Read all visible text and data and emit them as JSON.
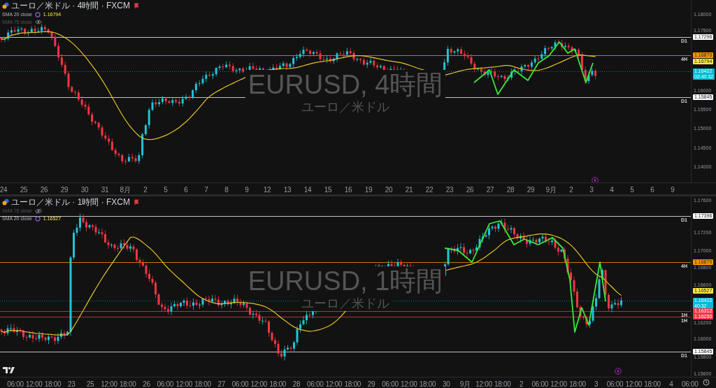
{
  "panes": [
    {
      "header": {
        "title": "ユーロ／米ドル · 4時間 · FXCM"
      },
      "indicators": [
        {
          "name": "SMA 20 close",
          "visible": true,
          "value": "1.16794"
        },
        {
          "name": "SMA 75 close",
          "visible": false
        }
      ],
      "watermark": {
        "symbol": "EURUSD, 4時間",
        "description": "ユーロ／米ドル"
      },
      "price_axis": [
        "1.18000",
        "1.17500",
        "1.16000",
        "1.15500",
        "1.15000",
        "1.14500",
        "1.14000"
      ],
      "price_tags": [
        {
          "kind": "level",
          "label": "D1",
          "price": "1.17296",
          "color": "#ffffff"
        },
        {
          "kind": "level",
          "label": "4H",
          "price": "1.16870",
          "color": "#ff9800"
        },
        {
          "kind": "indicator",
          "price": "1.16794",
          "color": "#ffeb3b"
        },
        {
          "kind": "last",
          "price": "1.16422",
          "countdown": "02:40:32",
          "color": "#00bcd4"
        },
        {
          "kind": "level",
          "label": "D1",
          "price": "1.15845",
          "color": "#ffffff"
        }
      ],
      "time_axis": [
        "24",
        "25",
        "26",
        "29",
        "30",
        "31",
        "8月",
        "2",
        "5",
        "6",
        "7",
        "8",
        "9",
        "12",
        "13",
        "14",
        "15",
        "16",
        "19",
        "20",
        "21",
        "22",
        "23",
        "26",
        "27",
        "28",
        "29",
        "9月",
        "2",
        "3",
        "4",
        "5",
        "6",
        "9"
      ]
    },
    {
      "header": {
        "title": "ユーロ／米ドル · 1時間 · FXCM"
      },
      "indicators": [
        {
          "name": "SMA 75 close",
          "visible": false
        },
        {
          "name": "SMA 20 close",
          "visible": true,
          "value": "1.16527"
        }
      ],
      "watermark": {
        "symbol": "EURUSD, 1時間",
        "description": "ユーロ／米ドル"
      },
      "price_axis": [
        "1.17600",
        "1.17200",
        "1.17000",
        "1.16800",
        "1.16600",
        "1.16200",
        "1.16000",
        "1.15800",
        "1.15600"
      ],
      "price_tags": [
        {
          "kind": "level",
          "label": "D1",
          "price": "1.17396",
          "color": "#ffffff"
        },
        {
          "kind": "level",
          "label": "4H",
          "price": "1.16870",
          "color": "#ff9800"
        },
        {
          "kind": "indicator",
          "price": "1.16527",
          "color": "#ffeb3b"
        },
        {
          "kind": "last",
          "price": "1.16422",
          "countdown": "40:32",
          "color": "#00bcd4"
        },
        {
          "kind": "level",
          "label": "1H",
          "price": "1.16312",
          "color": "#f23645"
        },
        {
          "kind": "level",
          "label": "1H",
          "price": "1.16250",
          "color": "#f23645"
        },
        {
          "kind": "level",
          "label": "D1",
          "price": "1.15845",
          "color": "#ffffff"
        }
      ],
      "time_axis": [
        "06:00",
        "12:00",
        "18:00",
        "23",
        "25",
        "12:00",
        "18:00",
        "26",
        "06:00",
        "12:00",
        "18:00",
        "27",
        "06:00",
        "12:00",
        "18:00",
        "28",
        "06:00",
        "12:00",
        "18:00",
        "29",
        "06:00",
        "12:00",
        "18:00",
        "30",
        "9月",
        "12:00",
        "18:00",
        "2",
        "06:00",
        "12:00",
        "18:00",
        "3",
        "06:00",
        "12:00",
        "18:00",
        "4",
        "06:00"
      ]
    }
  ]
}
